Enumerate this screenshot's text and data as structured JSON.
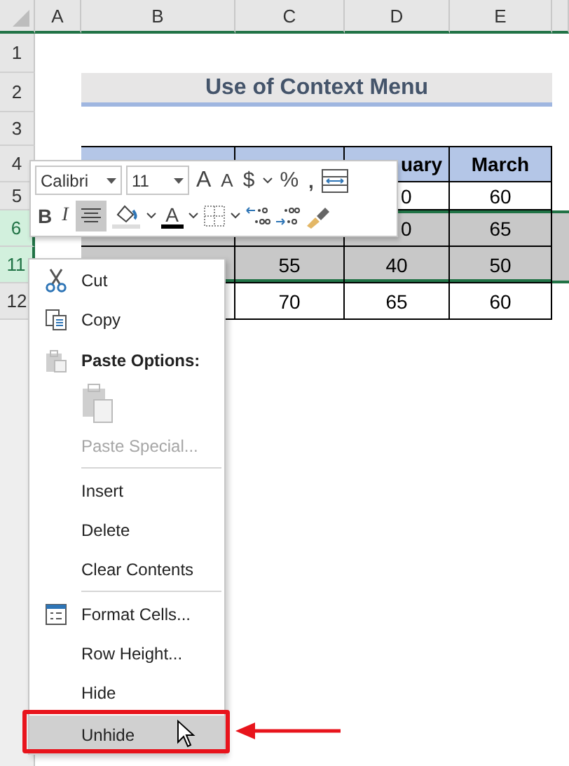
{
  "columns": [
    "A",
    "B",
    "C",
    "D",
    "E"
  ],
  "rows": [
    {
      "header": "1",
      "kind": "blank",
      "selected": false
    },
    {
      "header": "2",
      "kind": "title",
      "selected": false,
      "title": "Use of Context Menu"
    },
    {
      "header": "3",
      "kind": "blank",
      "selected": false
    },
    {
      "header": "4",
      "kind": "table_header",
      "selected": false,
      "cells": [
        null,
        null,
        "uary",
        "March"
      ]
    },
    {
      "header": "5",
      "kind": "data",
      "selected": false,
      "cells": [
        null,
        null,
        "0",
        "60"
      ]
    },
    {
      "header": "6",
      "kind": "data",
      "selected": true,
      "cells": [
        null,
        null,
        "0",
        "65"
      ]
    },
    {
      "header": "11",
      "kind": "data",
      "selected": true,
      "cells": [
        null,
        "55",
        "40",
        "50"
      ]
    },
    {
      "header": "12",
      "kind": "data",
      "selected": false,
      "cells": [
        null,
        "70",
        "65",
        "60"
      ]
    }
  ],
  "toolbar": {
    "font": "Calibri",
    "size": "11",
    "grow_font": "A",
    "shrink_font": "A",
    "currency": "$",
    "percent": "%",
    "comma": ",",
    "bold": "B",
    "italic": "I",
    "align_center": {
      "selected": true
    },
    "font_color": "A"
  },
  "menu": [
    {
      "label": "Cut",
      "kind": "command",
      "disabled": false,
      "selected": false
    },
    {
      "label": "Copy",
      "kind": "command",
      "disabled": false,
      "selected": false
    },
    {
      "label": "Paste Options:",
      "kind": "heading"
    },
    {
      "kind": "paste_button"
    },
    {
      "label": "Paste Special...",
      "kind": "command",
      "disabled": true,
      "selected": false
    },
    {
      "kind": "separator"
    },
    {
      "label": "Insert",
      "kind": "command",
      "disabled": false,
      "selected": false
    },
    {
      "label": "Delete",
      "kind": "command",
      "disabled": false,
      "selected": false
    },
    {
      "label": "Clear Contents",
      "kind": "command",
      "disabled": false,
      "selected": false
    },
    {
      "kind": "separator"
    },
    {
      "label": "Format Cells...",
      "kind": "command",
      "disabled": false,
      "selected": false
    },
    {
      "label": "Row Height...",
      "kind": "command",
      "disabled": false,
      "selected": false
    },
    {
      "label": "Hide",
      "kind": "command",
      "disabled": false,
      "selected": false
    },
    {
      "label": "Unhide",
      "kind": "command",
      "disabled": false,
      "selected": true
    }
  ]
}
